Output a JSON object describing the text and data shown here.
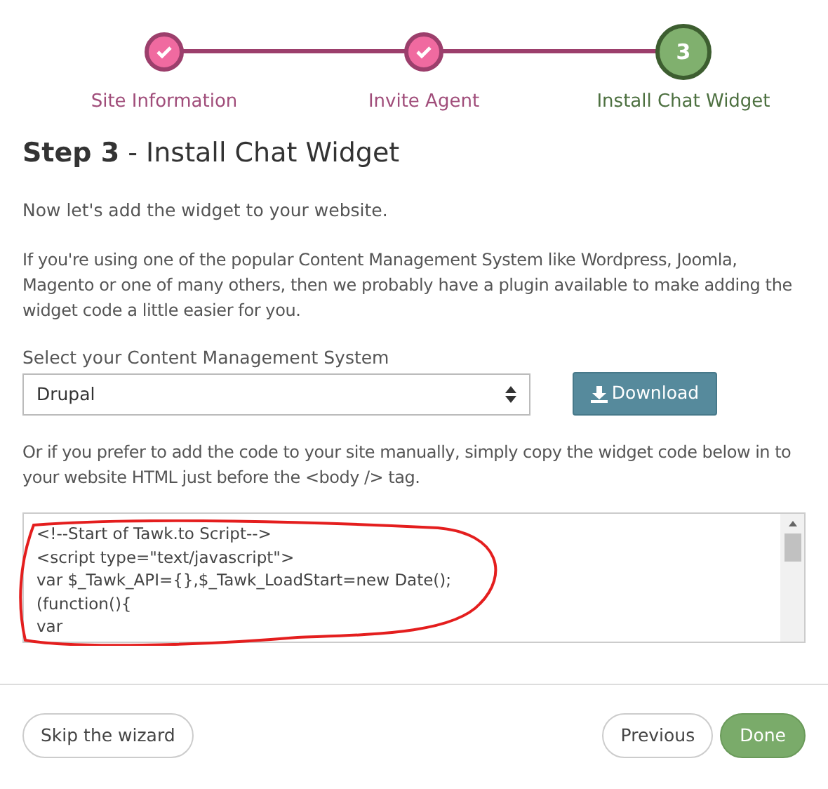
{
  "steps": [
    {
      "label": "Site Information",
      "completed": true
    },
    {
      "label": "Invite Agent",
      "completed": true
    },
    {
      "label": "Install Chat Widget",
      "completed": false,
      "number": "3"
    }
  ],
  "heading": "**Step 3** - Install Chat Widget",
  "paragraphs": [
    "Now let's add the widget to your website.",
    "If you're using one of the popular Content Management System like Wordpress, Joomla, Magento or one of many others, then we probably have a plugin available to make adding the widget code a little easier for you."
  ],
  "cms_select": {
    "label": "Select your Content Management System",
    "value": "Drupal"
  },
  "download_button": "Download",
  "manual_text": "Or if you prefer to add the code to your site manually, simply copy the widget code below in to your website HTML just before the <body /> tag.",
  "code_lines": [
    "<!--Start of Tawk.to Script-->",
    "<script type=\"text/javascript\">",
    "var $_Tawk_API={},$_Tawk_LoadStart=new Date();",
    "(function(){",
    "var"
  ],
  "footer": {
    "skip": "Skip the wizard",
    "previous": "Previous",
    "done": "Done"
  }
}
